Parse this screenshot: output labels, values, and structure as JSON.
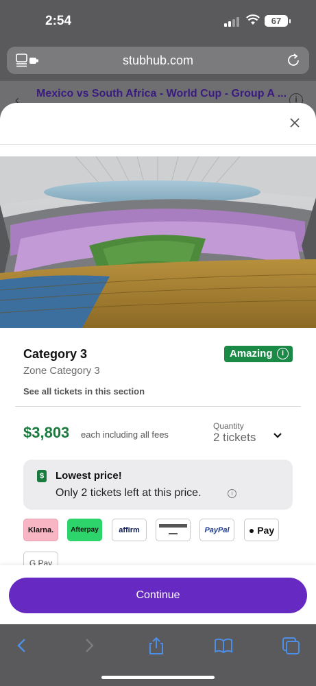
{
  "status_bar": {
    "time": "2:54",
    "battery": "67"
  },
  "browser": {
    "url": "stubhub.com"
  },
  "background_page": {
    "event_title": "Mexico vs South Africa - World Cup - Group A ..."
  },
  "listing": {
    "category": "Category 3",
    "badge": "Amazing",
    "zone": "Zone Category 3",
    "see_all": "See all tickets in this section",
    "price": "$3,803",
    "price_note": "each including all fees",
    "quantity_label": "Quantity",
    "quantity_value": "2 tickets",
    "lowest_title": "Lowest price!",
    "lowest_text": "Only 2 tickets left at this price.",
    "payments": [
      "Klarna.",
      "Afterpay",
      "affirm",
      "card",
      "PayPal",
      "Pay",
      "G Pay"
    ]
  },
  "footer": {
    "continue_label": "Continue"
  },
  "colors": {
    "accent": "#6629c1",
    "price": "#1b7a3e",
    "badge": "#1b8a47"
  },
  "icons": [
    "reader-icon",
    "reload-icon",
    "close-icon",
    "info-icon",
    "chevron-down-icon",
    "back-icon",
    "forward-icon",
    "share-icon",
    "bookmarks-icon",
    "tabs-icon"
  ]
}
